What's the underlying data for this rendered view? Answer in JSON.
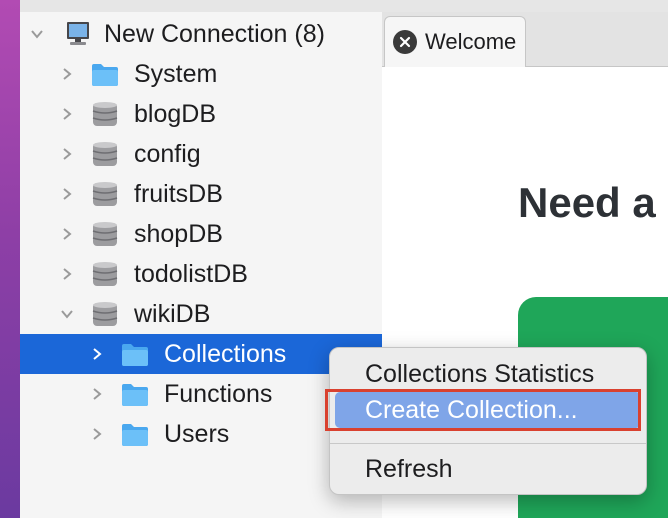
{
  "tree": {
    "items": [
      {
        "label": "New Connection (8)",
        "icon": "computer-icon",
        "expanded": true,
        "selected": false
      },
      {
        "label": "System",
        "icon": "folder-icon",
        "expanded": false,
        "selected": false
      },
      {
        "label": "blogDB",
        "icon": "database-icon",
        "expanded": false,
        "selected": false
      },
      {
        "label": "config",
        "icon": "database-icon",
        "expanded": false,
        "selected": false
      },
      {
        "label": "fruitsDB",
        "icon": "database-icon",
        "expanded": false,
        "selected": false
      },
      {
        "label": "shopDB",
        "icon": "database-icon",
        "expanded": false,
        "selected": false
      },
      {
        "label": "todolistDB",
        "icon": "database-icon",
        "expanded": false,
        "selected": false
      },
      {
        "label": "wikiDB",
        "icon": "database-icon",
        "expanded": true,
        "selected": false
      },
      {
        "label": "Collections",
        "icon": "folder-icon",
        "expanded": false,
        "selected": true
      },
      {
        "label": "Functions",
        "icon": "folder-icon",
        "expanded": false,
        "selected": false
      },
      {
        "label": "Users",
        "icon": "folder-icon",
        "expanded": false,
        "selected": false
      }
    ]
  },
  "tabs": [
    {
      "label": "Welcome",
      "icon": "close-icon"
    }
  ],
  "content": {
    "heading": "Need a"
  },
  "context_menu": {
    "items": [
      {
        "label": "Collections Statistics",
        "highlighted": false
      },
      {
        "label": "Create Collection...",
        "highlighted": true
      },
      {
        "label": "Refresh",
        "highlighted": false
      }
    ]
  },
  "colors": {
    "selection": "#1b67d8",
    "menu_highlight": "#7fa5e8",
    "callout": "#d9412f",
    "folder": "#5ab3f5",
    "card": "#1fa659"
  }
}
